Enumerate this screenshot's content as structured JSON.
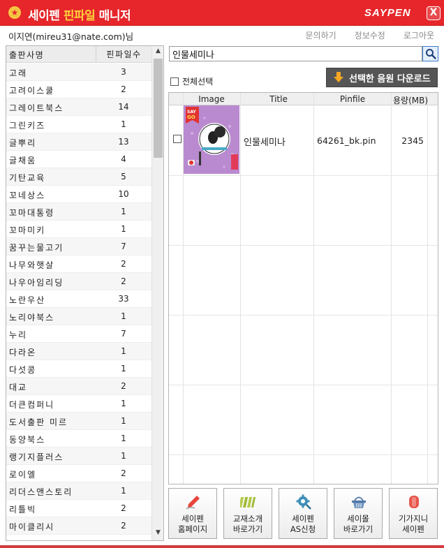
{
  "app": {
    "title_part1": "세이펜 ",
    "title_part2": "핀파일",
    "title_part3": " 매니저",
    "brand": "SAYPEN",
    "close_glyph": "X"
  },
  "user": {
    "info": "이지연(mireu31@nate.com)님",
    "links": [
      "문의하기",
      "정보수정",
      "로그아웃"
    ]
  },
  "publishers": {
    "header_name": "출판사명",
    "header_count": "핀파일수",
    "rows": [
      {
        "name": "고래",
        "count": "3"
      },
      {
        "name": "고려이스쿨",
        "count": "2"
      },
      {
        "name": "그레이트북스",
        "count": "14"
      },
      {
        "name": "그린키즈",
        "count": "1"
      },
      {
        "name": "글뿌리",
        "count": "13"
      },
      {
        "name": "글채움",
        "count": "4"
      },
      {
        "name": "기탄교육",
        "count": "5"
      },
      {
        "name": "꼬네상스",
        "count": "10"
      },
      {
        "name": "꼬마대통령",
        "count": "1"
      },
      {
        "name": "꼬마미키",
        "count": "1"
      },
      {
        "name": "꿈꾸는물고기",
        "count": "7"
      },
      {
        "name": "나무와햇살",
        "count": "2"
      },
      {
        "name": "나우아임리딩",
        "count": "2"
      },
      {
        "name": "노란우산",
        "count": "33"
      },
      {
        "name": "노리야북스",
        "count": "1"
      },
      {
        "name": "누리",
        "count": "7"
      },
      {
        "name": "다라온",
        "count": "1"
      },
      {
        "name": "다섯콩",
        "count": "1"
      },
      {
        "name": "대교",
        "count": "2"
      },
      {
        "name": "더큰컴퍼니",
        "count": "1"
      },
      {
        "name": "도서출판 미르",
        "count": "1"
      },
      {
        "name": "동양북스",
        "count": "1"
      },
      {
        "name": "랭기지플러스",
        "count": "1"
      },
      {
        "name": "로이엘",
        "count": "2"
      },
      {
        "name": "리더스앤스토리",
        "count": "1"
      },
      {
        "name": "리틀빅",
        "count": "2"
      },
      {
        "name": "마이클리시",
        "count": "2"
      }
    ]
  },
  "search": {
    "value": "인물세미나"
  },
  "select_all_label": "전체선택",
  "download_label": "선택한 음원 다운로드",
  "table": {
    "headers": {
      "image": "Image",
      "title": "Title",
      "pinfile": "Pinfile",
      "size": "용량(MB)"
    },
    "rows": [
      {
        "title": "인물세미나",
        "pinfile": "64261_bk.pin",
        "size": "2345",
        "thumb_badge": "SAY GO",
        "thumb_accent": "#b87fcf"
      }
    ]
  },
  "bottom_buttons": [
    {
      "line1": "세이펜",
      "line2": "홈페이지",
      "icon": "pen-icon"
    },
    {
      "line1": "교재소개",
      "line2": "바로가기",
      "icon": "books-icon"
    },
    {
      "line1": "세이펜",
      "line2": "AS신청",
      "icon": "gear-icon"
    },
    {
      "line1": "세이몰",
      "line2": "바로가기",
      "icon": "basket-icon"
    },
    {
      "line1": "기가지니",
      "line2": "세이펜",
      "icon": "genie-icon"
    }
  ]
}
